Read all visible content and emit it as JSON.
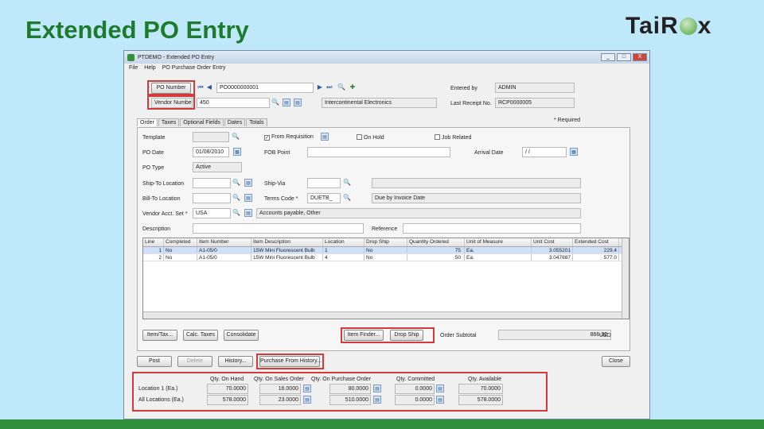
{
  "slide": {
    "title": "Extended PO Entry",
    "logo": {
      "left": "Tai",
      "right": "x",
      "mid": "R",
      "icon": "globe-icon"
    }
  },
  "window": {
    "title": "PTDEMO - Extended PO Entry",
    "buttons": [
      "_",
      "□",
      "X"
    ],
    "menu": [
      "File",
      "Help",
      "PO Purchase Order Entry"
    ]
  },
  "header": {
    "po_number_label": "PO Number",
    "po_number": "PO0000000001",
    "vendor_label": "Vendor Number",
    "vendor_number": "450",
    "vendor_name": "Intercontinental Electronics",
    "entered_by_label": "Entered by",
    "entered_by": "ADMIN",
    "last_receipt_label": "Last Receipt No.",
    "last_receipt": "RCP0000005"
  },
  "tabs": [
    "Order",
    "Taxes",
    "Optional Fields",
    "Dates",
    "Totals"
  ],
  "required": "* Required",
  "order": {
    "template_label": "Template",
    "template": "",
    "from_requisition_label": "From Requisition",
    "on_hold_label": "On Hold",
    "job_related_label": "Job Related",
    "po_date_label": "PO Date",
    "po_date": "01/08/2010",
    "fob_label": "FOB Point",
    "fob": "",
    "arrival_label": "Arrival Date",
    "arrival": "/ /",
    "po_type_label": "PO Type",
    "po_type": "Active",
    "shipto_label": "Ship-To Location",
    "shipto": "",
    "shipvia_label": "Ship-Via",
    "shipvia": "",
    "shipvia_desc": "",
    "billto_label": "Bill-To Location",
    "billto": "",
    "terms_label": "Terms Code *",
    "terms": "DUETB_",
    "terms_desc": "Due by Invoice Date",
    "vendor_acct_label": "Vendor Acct. Set *",
    "vendor_acct": "USA",
    "vendor_acct_desc": "Accounts payable, Other",
    "description_label": "Description",
    "description": "",
    "reference_label": "Reference",
    "reference": ""
  },
  "grid": {
    "columns": [
      "Line",
      "Completed",
      "Item Number",
      "Item Description",
      "Location",
      "Drop Ship",
      "Quantity Ordered",
      "Unit of Measure",
      "Unit Cost",
      "Extended Cost"
    ],
    "rows": [
      {
        "line": "1",
        "completed": "No",
        "item": "A1-05/0",
        "desc": "15W Mini Fluorescent Bulb",
        "loc": "1",
        "drop": "No",
        "qty": "75",
        "uom": "Ea.",
        "cost": "3.055201",
        "ext": "229.4"
      },
      {
        "line": "2",
        "completed": "No",
        "item": "A1-05/0",
        "desc": "15W Mini Fluorescent Bulb",
        "loc": "4",
        "drop": "No",
        "qty": "50",
        "uom": "Ea.",
        "cost": "3.047887",
        "ext": "577.0"
      }
    ]
  },
  "actions": {
    "item_tax": "Item/Tax...",
    "calc_taxes": "Calc. Taxes",
    "consolidate": "Consolidate",
    "item_finder": "Item Finder...",
    "drop_ship": "Drop Ship",
    "subtotal_label": "Order Subtotal",
    "subtotal": "866.32",
    "currency": "USD"
  },
  "footer": {
    "post": "Post",
    "delete": "Delete",
    "history": "History...",
    "purchase_history": "Purchase From History...",
    "close": "Close"
  },
  "locations": {
    "headers": [
      "Qty. On Hand",
      "Qty. On Sales Order",
      "Qty. On Purchase Order",
      "Qty. Committed",
      "Qty. Available"
    ],
    "rows": [
      {
        "label": "Location 1 (Ea.)",
        "values": [
          "70.0000",
          "16.0000",
          "80.0000",
          "0.0000",
          "70.0000"
        ]
      },
      {
        "label": "All Locations (Ea.)",
        "values": [
          "578.0000",
          "23.0000",
          "510.0000",
          "0.0000",
          "578.0000"
        ]
      }
    ]
  },
  "colors": {
    "title_green": "#1e7a2e",
    "highlight_red": "#d43a3a",
    "background": "#bfe9fb"
  }
}
